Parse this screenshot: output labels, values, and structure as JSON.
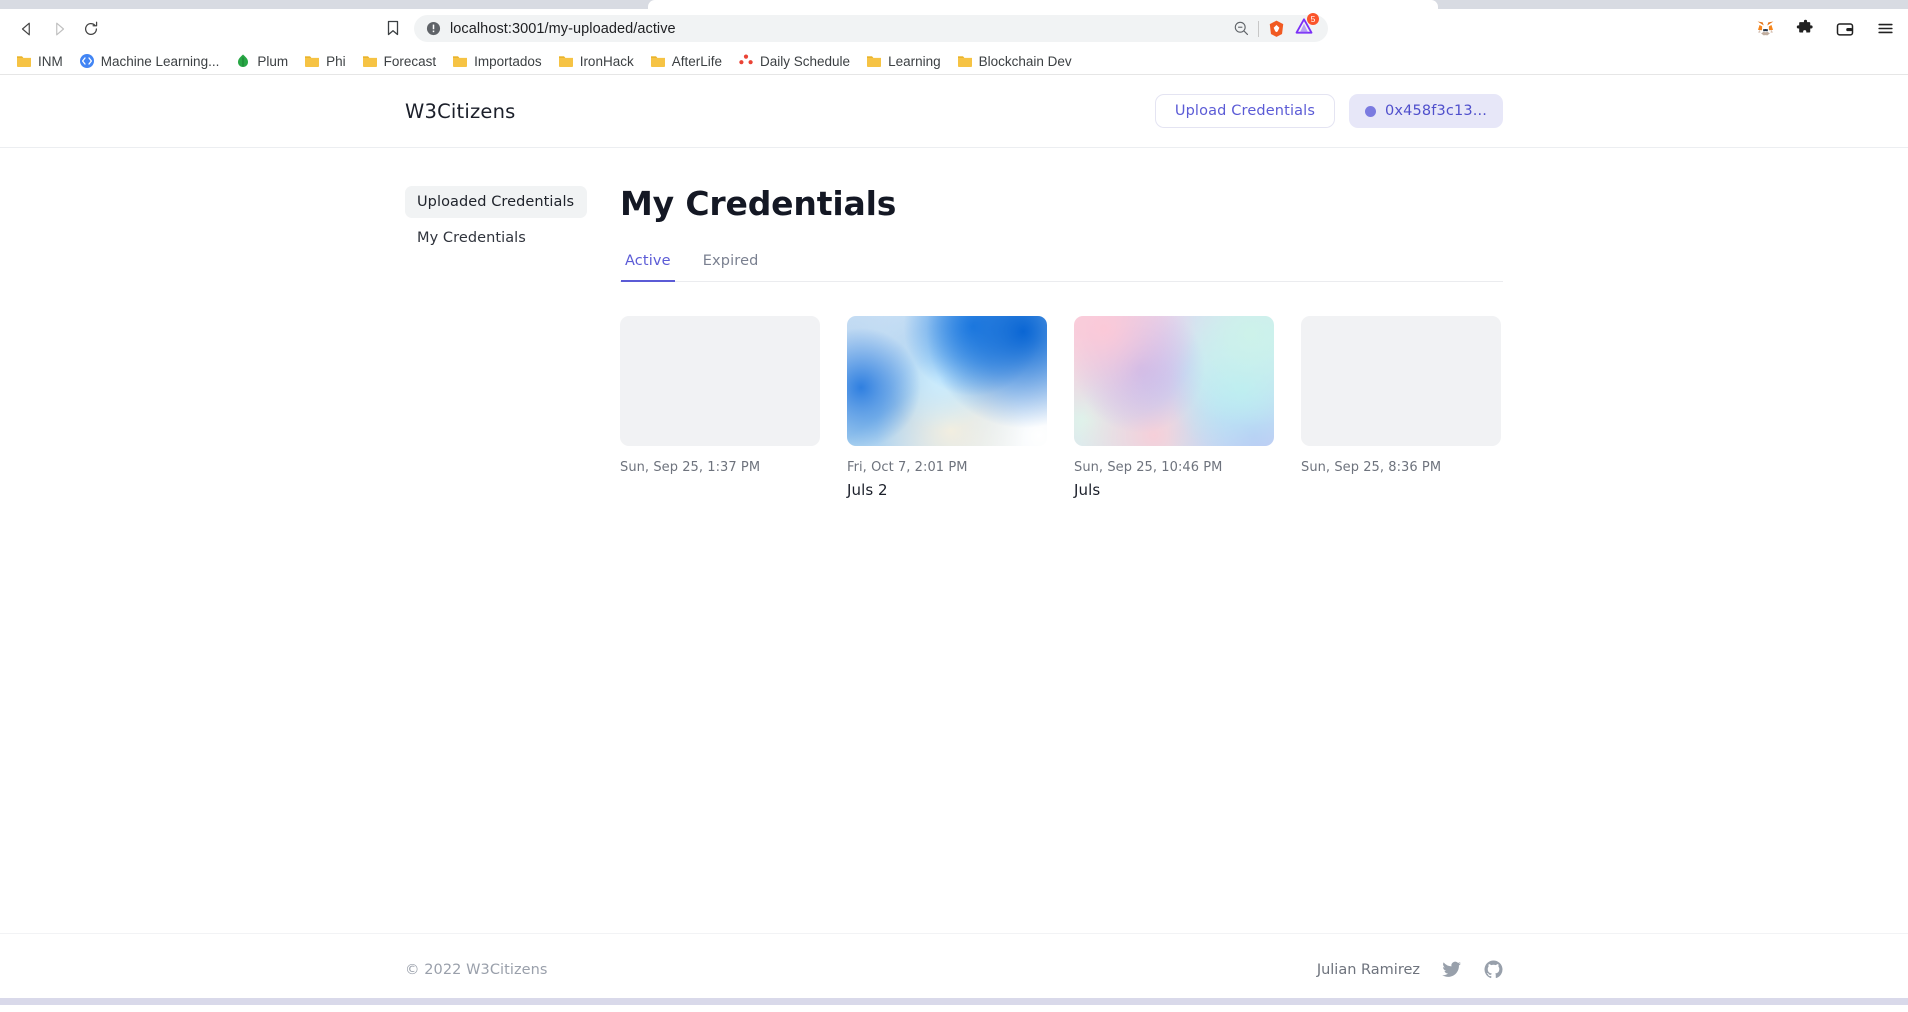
{
  "browser": {
    "nav": {
      "back": "back-arrow",
      "forward": "forward-arrow",
      "reload": "reload-arrow"
    },
    "bookmark_star": "bookmark-icon",
    "omnibox": {
      "security_icon": "not-secure-info-icon",
      "url": "localhost:3001/my-uploaded/active",
      "zoom_out_icon": "zoom-out-icon",
      "brave_shields_icon": "brave-lion-icon",
      "brave_rewards_icon": "brave-triangle-icon",
      "rewards_badge": "5"
    },
    "extensions": [
      {
        "name": "metamask-fox-icon"
      },
      {
        "name": "extensions-puzzle-icon"
      },
      {
        "name": "wallet-icon"
      },
      {
        "name": "browser-menu-icon"
      }
    ],
    "bookmarks": [
      {
        "label": "INM",
        "icon": "folder-icon"
      },
      {
        "label": "Machine Learning...",
        "icon": "code-brackets-icon"
      },
      {
        "label": "Plum",
        "icon": "plum-leaf-icon"
      },
      {
        "label": "Phi",
        "icon": "folder-icon"
      },
      {
        "label": "Forecast",
        "icon": "folder-icon"
      },
      {
        "label": "Importados",
        "icon": "folder-icon"
      },
      {
        "label": "IronHack",
        "icon": "folder-icon"
      },
      {
        "label": "AfterLife",
        "icon": "folder-icon"
      },
      {
        "label": "Daily Schedule",
        "icon": "people-red-icon"
      },
      {
        "label": "Learning",
        "icon": "folder-icon"
      },
      {
        "label": "Blockchain Dev",
        "icon": "folder-icon"
      }
    ]
  },
  "app": {
    "header": {
      "brand": "W3Citizens",
      "upload_button": "Upload Credentials",
      "wallet_button": "0x458f3c13...",
      "wallet_dot_color": "#7b7be0"
    },
    "sidebar": {
      "items": [
        {
          "label": "Uploaded Credentials",
          "active": true
        },
        {
          "label": "My Credentials",
          "active": false
        }
      ]
    },
    "main": {
      "title": "My Credentials",
      "tabs": [
        {
          "label": "Active",
          "active": true
        },
        {
          "label": "Expired",
          "active": false
        }
      ],
      "accent_color": "#5b5bd6",
      "cards": [
        {
          "date": "Sun, Sep 25, 1:37 PM",
          "name": "",
          "thumb_style": "placeholder"
        },
        {
          "date": "Fri, Oct 7, 2:01 PM",
          "name": "Juls 2",
          "thumb_style": "blue"
        },
        {
          "date": "Sun, Sep 25, 10:46 PM",
          "name": "Juls",
          "thumb_style": "pastel"
        },
        {
          "date": "Sun, Sep 25, 8:36 PM",
          "name": "",
          "thumb_style": "placeholder"
        }
      ]
    },
    "footer": {
      "copyright": "© 2022 W3Citizens",
      "author": "Julian Ramirez",
      "social": [
        {
          "name": "twitter-icon"
        },
        {
          "name": "github-icon"
        }
      ]
    }
  }
}
